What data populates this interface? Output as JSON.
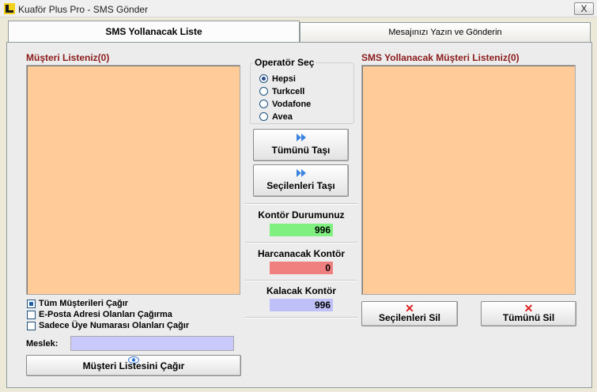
{
  "window": {
    "title": "Kuaför Plus Pro - SMS Gönder",
    "close_symbol": "X"
  },
  "tabs": [
    {
      "label": "SMS Yollanacak Liste",
      "active": true
    },
    {
      "label": "Mesajınızı Yazın ve Gönderin",
      "active": false
    }
  ],
  "left": {
    "title": "Müşteri Listeniz(0)",
    "checkboxes": [
      {
        "label": "Tüm Müşterileri Çağır",
        "checked": true
      },
      {
        "label": "E-Posta Adresi Olanları Çağırma",
        "checked": false
      },
      {
        "label": "Sadece Üye Numarası Olanları Çağır",
        "checked": false
      }
    ],
    "meslek_label": "Meslek:",
    "meslek_value": "",
    "load_button": "Müşteri Listesini Çağır"
  },
  "operator": {
    "title": "Operatör Seç",
    "options": [
      "Hepsi",
      "Turkcell",
      "Vodafone",
      "Avea"
    ],
    "selected": "Hepsi"
  },
  "middle": {
    "move_all_button": "Tümünü Taşı",
    "move_selected_button": "Seçilenleri Taşı",
    "kontor_durumu_label": "Kontör Durumunuz",
    "kontor_durumu_value": "996",
    "harcanacak_label": "Harcanacak Kontör",
    "harcanacak_value": "0",
    "kalacak_label": "Kalacak Kontör",
    "kalacak_value": "996"
  },
  "right": {
    "title": "SMS Yollanacak Müşteri Listeniz(0)",
    "delete_selected_button": "Seçilenleri Sil",
    "delete_all_button": "Tümünü Sil"
  },
  "colors": {
    "list_bg": "#ffcc99",
    "section_title": "#8b1a1a",
    "gauge_green": "#80f080",
    "gauge_red": "#f08080",
    "gauge_blue": "#c0c0f8",
    "meslek_bg": "#c9c9fb"
  },
  "icons": {
    "move": "double-chevron-right-icon",
    "delete": "red-x-icon",
    "load": "eye-icon"
  }
}
